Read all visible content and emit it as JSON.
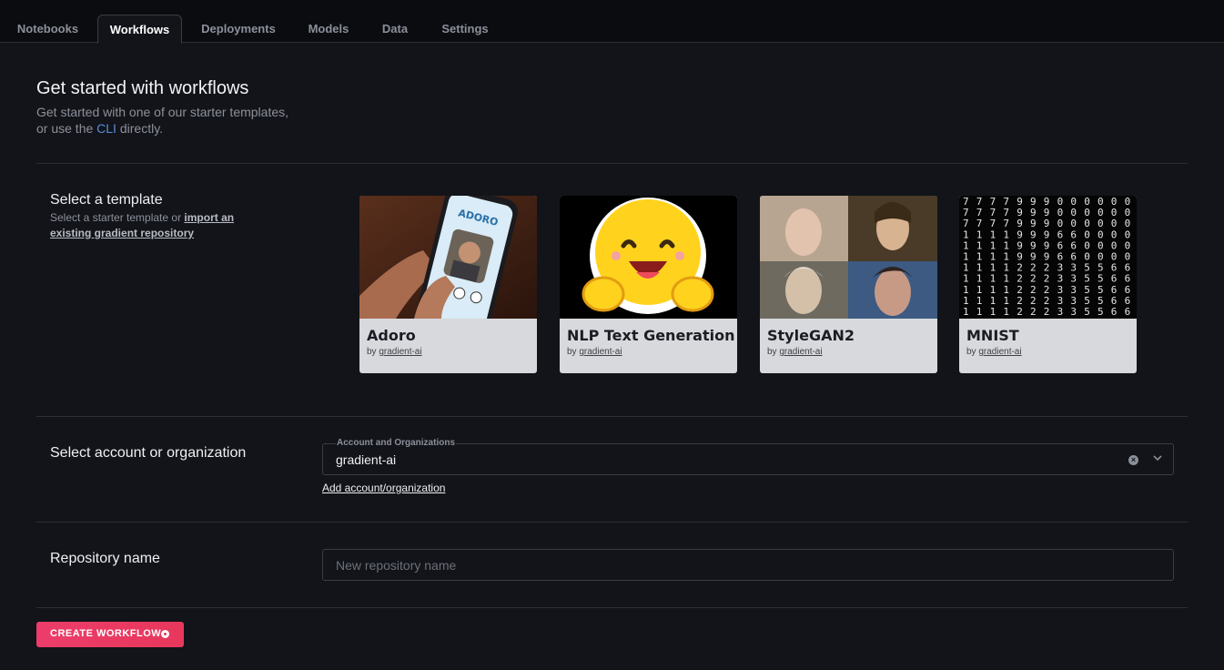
{
  "tabs": [
    {
      "label": "Notebooks",
      "active": false
    },
    {
      "label": "Workflows",
      "active": true
    },
    {
      "label": "Deployments",
      "active": false
    },
    {
      "label": "Models",
      "active": false
    },
    {
      "label": "Data",
      "active": false
    },
    {
      "label": "Settings",
      "active": false
    }
  ],
  "header": {
    "title": "Get started with workflows",
    "subtitle_line1": "Get started with one of our starter templates,",
    "subtitle_prefix": "or use the",
    "subtitle_link": "CLI",
    "subtitle_suffix": "directly."
  },
  "template_section": {
    "label": "Select a template",
    "help_prefix": "Select a starter template or",
    "help_link": "import an existing gradient repository"
  },
  "templates": [
    {
      "title": "Adoro",
      "by_prefix": "by",
      "author": "gradient-ai",
      "image_icon": "phone-app-icon"
    },
    {
      "title": "NLP Text Generation",
      "by_prefix": "by",
      "author": "gradient-ai",
      "image_icon": "hugging-face-icon"
    },
    {
      "title": "StyleGAN2",
      "by_prefix": "by",
      "author": "gradient-ai",
      "image_icon": "portraits-icon"
    },
    {
      "title": "MNIST",
      "by_prefix": "by",
      "author": "gradient-ai",
      "image_icon": "digits-grid-icon"
    }
  ],
  "account_section": {
    "label": "Select account or organization",
    "field_label": "Account and Organizations",
    "value": "gradient-ai",
    "add_link": "Add account/organization"
  },
  "repo_section": {
    "label": "Repository name",
    "placeholder": "New repository name",
    "value": ""
  },
  "create_button": {
    "label": "CREATE WORKFLOW"
  },
  "colors": {
    "background": "#121419",
    "accent": "#e8375c",
    "link": "#5b8ddb"
  }
}
